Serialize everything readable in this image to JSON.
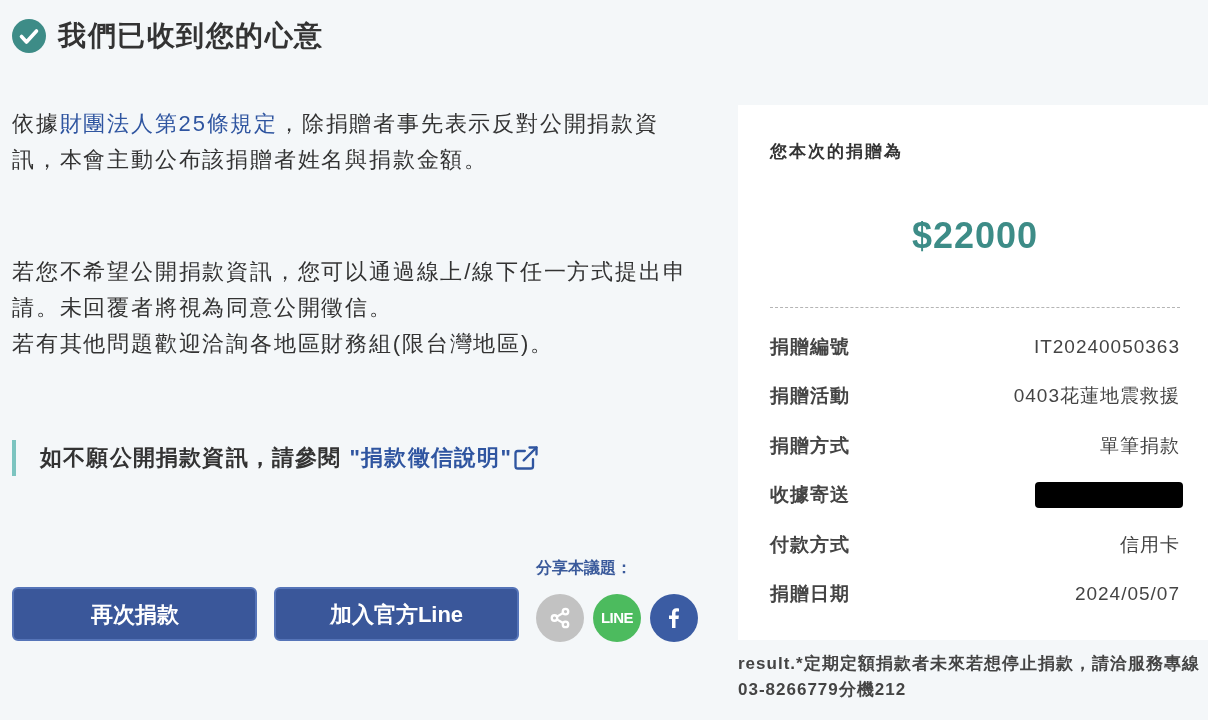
{
  "header": {
    "title": "我們已收到您的心意"
  },
  "intro": {
    "before": "依據",
    "link": "財團法人第25條規定",
    "after": "，除捐贈者事先表示反對公開捐款資訊，本會主動公布該捐贈者姓名與捐款金額。"
  },
  "privacy_notes": [
    "若您不希望公開捐款資訊，您可以通過線上/線下任一方式提出申請。未回覆者將視為同意公開徵信。",
    "若有其他問題歡迎洽詢各地區財務組(限台灣地區)。"
  ],
  "notice": {
    "text": "如不願公開捐款資訊，請參閱",
    "link": "\"捐款徵信說明\""
  },
  "buttons": [
    "再次捐款",
    "加入官方Line"
  ],
  "share": {
    "label": "分享本議題：",
    "items": [
      {
        "kind": "share"
      },
      {
        "kind": "line",
        "label": "LINE"
      },
      {
        "kind": "facebook"
      }
    ]
  },
  "summary": {
    "title": "您本次的捐贈為",
    "amount": "$22000",
    "rows": [
      {
        "label": "捐贈編號",
        "value": "IT20240050363",
        "redacted": false
      },
      {
        "label": "捐贈活動",
        "value": "0403花蓮地震救援",
        "redacted": false
      },
      {
        "label": "捐贈方式",
        "value": "單筆捐款",
        "redacted": false
      },
      {
        "label": "收據寄送",
        "redacted": true
      },
      {
        "label": "付款方式",
        "value": "信用卡",
        "redacted": false
      },
      {
        "label": "捐贈日期",
        "value": "2024/05/07",
        "redacted": false
      }
    ]
  },
  "footnote": "result.*定期定額捐款者未來若想停止捐款，請洽服務專線03-8266779分機212"
}
